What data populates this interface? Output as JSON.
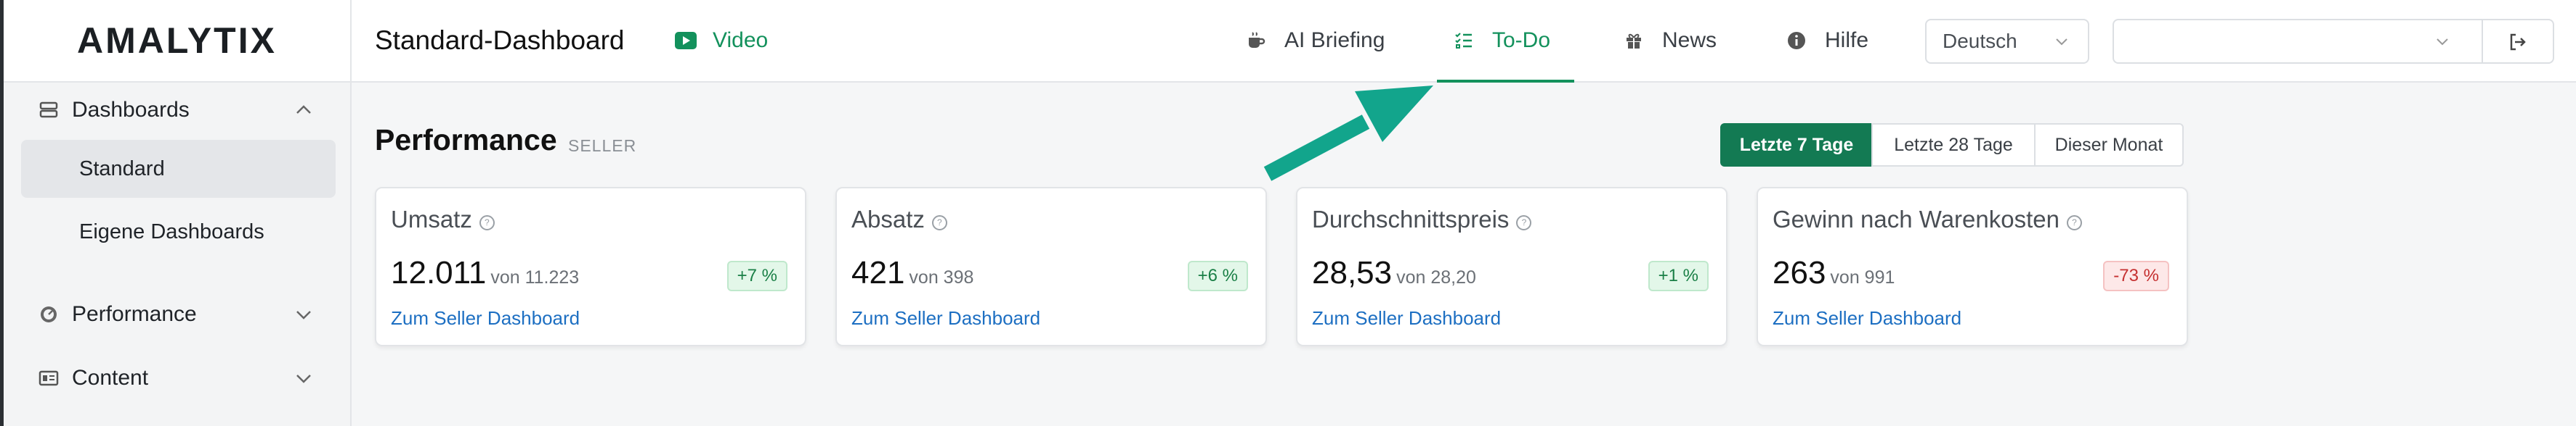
{
  "app": {
    "logo": "AMALYTIX"
  },
  "sidebar": {
    "groups": [
      {
        "label": "Dashboards",
        "icon": "dashboard-icon",
        "expanded": true,
        "items": [
          {
            "label": "Standard",
            "active": true
          },
          {
            "label": "Eigene Dashboards",
            "active": false
          }
        ]
      },
      {
        "label": "Performance",
        "icon": "gauge-icon",
        "expanded": false
      },
      {
        "label": "Content",
        "icon": "content-icon",
        "expanded": false
      }
    ]
  },
  "header": {
    "title": "Standard-Dashboard",
    "video_label": "Video",
    "tabs": [
      {
        "label": "AI Briefing",
        "icon": "coffee-icon",
        "active": false
      },
      {
        "label": "To-Do",
        "icon": "checklist-icon",
        "active": true
      },
      {
        "label": "News",
        "icon": "gift-icon",
        "active": false
      },
      {
        "label": "Hilfe",
        "icon": "info-icon",
        "active": false
      }
    ],
    "language": "Deutsch",
    "account": ""
  },
  "performance": {
    "title": "Performance",
    "subtitle": "SELLER",
    "ranges": [
      {
        "label": "Letzte 7 Tage",
        "active": true
      },
      {
        "label": "Letzte 28 Tage",
        "active": false
      },
      {
        "label": "Dieser Monat",
        "active": false
      }
    ],
    "cards": [
      {
        "title": "Umsatz",
        "value": "12.011",
        "compare": "von 11.223",
        "change": "+7 %",
        "trend": "positive",
        "link": "Zum Seller Dashboard"
      },
      {
        "title": "Absatz",
        "value": "421",
        "compare": "von 398",
        "change": "+6 %",
        "trend": "positive",
        "link": "Zum Seller Dashboard"
      },
      {
        "title": "Durchschnittspreis",
        "value": "28,53",
        "compare": "von 28,20",
        "change": "+1 %",
        "trend": "positive",
        "link": "Zum Seller Dashboard"
      },
      {
        "title": "Gewinn nach Warenkosten",
        "value": "263",
        "compare": "von 991",
        "change": "-73 %",
        "trend": "negative",
        "link": "Zum Seller Dashboard"
      }
    ]
  },
  "colors": {
    "accent": "#13915c",
    "accent_dark": "#137a53",
    "link": "#1d6fc2",
    "negative": "#c53030",
    "arrow": "#12a58c"
  }
}
